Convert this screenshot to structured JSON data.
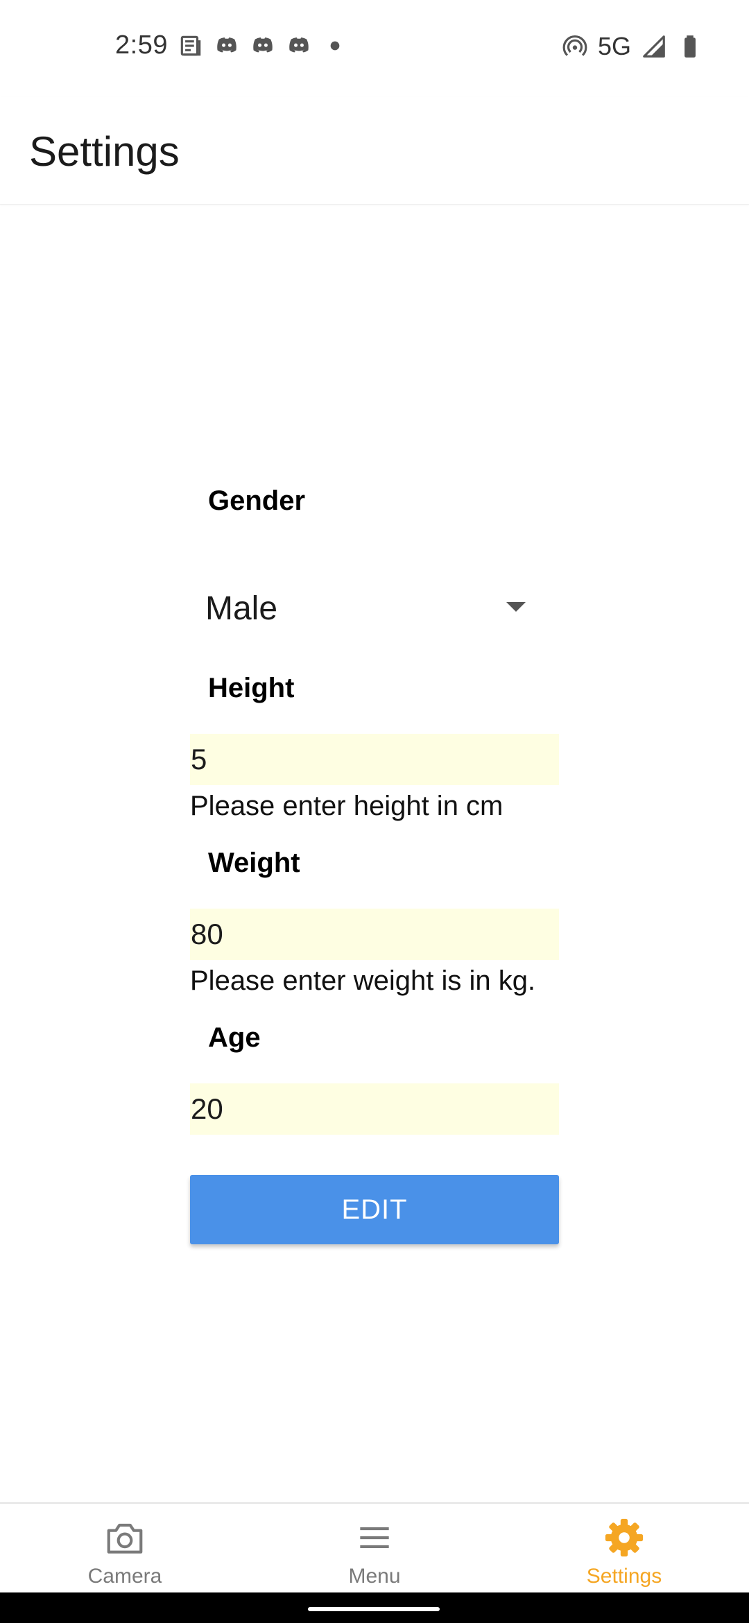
{
  "status_bar": {
    "time": "2:59",
    "network": "5G",
    "left_icons": [
      "news-icon",
      "discord-icon",
      "discord-icon",
      "discord-icon",
      "dot-icon"
    ],
    "right_icons": [
      "hotspot-icon",
      "signal-icon",
      "battery-icon"
    ]
  },
  "app_bar": {
    "title": "Settings"
  },
  "form": {
    "gender": {
      "label": "Gender",
      "value": "Male"
    },
    "height": {
      "label": "Height",
      "value": "5",
      "helper": "Please enter height in cm"
    },
    "weight": {
      "label": "Weight",
      "value": "80",
      "helper": "Please enter weight is in kg."
    },
    "age": {
      "label": "Age",
      "value": "20"
    },
    "edit_button": "EDIT"
  },
  "bottom_nav": {
    "items": [
      {
        "label": "Camera",
        "icon": "camera-icon"
      },
      {
        "label": "Menu",
        "icon": "menu-icon"
      },
      {
        "label": "Settings",
        "icon": "gear-icon",
        "active": true
      }
    ]
  },
  "colors": {
    "accent": "#f5a623",
    "button": "#4a91e8",
    "input_bg": "#fefee2"
  }
}
